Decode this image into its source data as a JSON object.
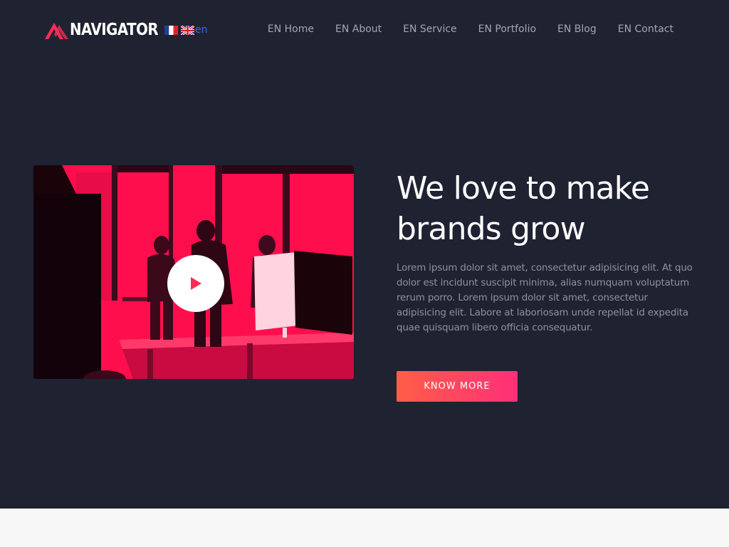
{
  "brand": {
    "name": "NAVIGATOR",
    "logo_icon": "navigator-chevron-logo-icon",
    "accent_color": "#ff2d55"
  },
  "languages": {
    "flags": [
      "flag-fr-icon",
      "flag-uk-icon"
    ],
    "current": "en"
  },
  "nav": {
    "items": [
      {
        "label": "EN Home"
      },
      {
        "label": "EN About"
      },
      {
        "label": "EN Service"
      },
      {
        "label": "EN Portfolio"
      },
      {
        "label": "EN Blog"
      },
      {
        "label": "EN Contact"
      }
    ]
  },
  "hero": {
    "headline": "We love to make brands grow",
    "body": "Lorem ipsum dolor sit amet, consectetur adipisicing elit. At quo dolor est incidunt suscipit minima, alias numquam voluptatum rerum porro. Lorem ipsum dolor sit amet, consectetur adipisicing elit. Labore at laboriosam unde repellat id expedita quae quisquam libero officia consequatur.",
    "cta_label": "KNOW MORE",
    "video_icon": "play-icon",
    "colors": {
      "background": "#1f2231",
      "image_tint": "#ff0e4e",
      "cta_gradient_start": "#ff5e46",
      "cta_gradient_end": "#ff2f79"
    }
  }
}
